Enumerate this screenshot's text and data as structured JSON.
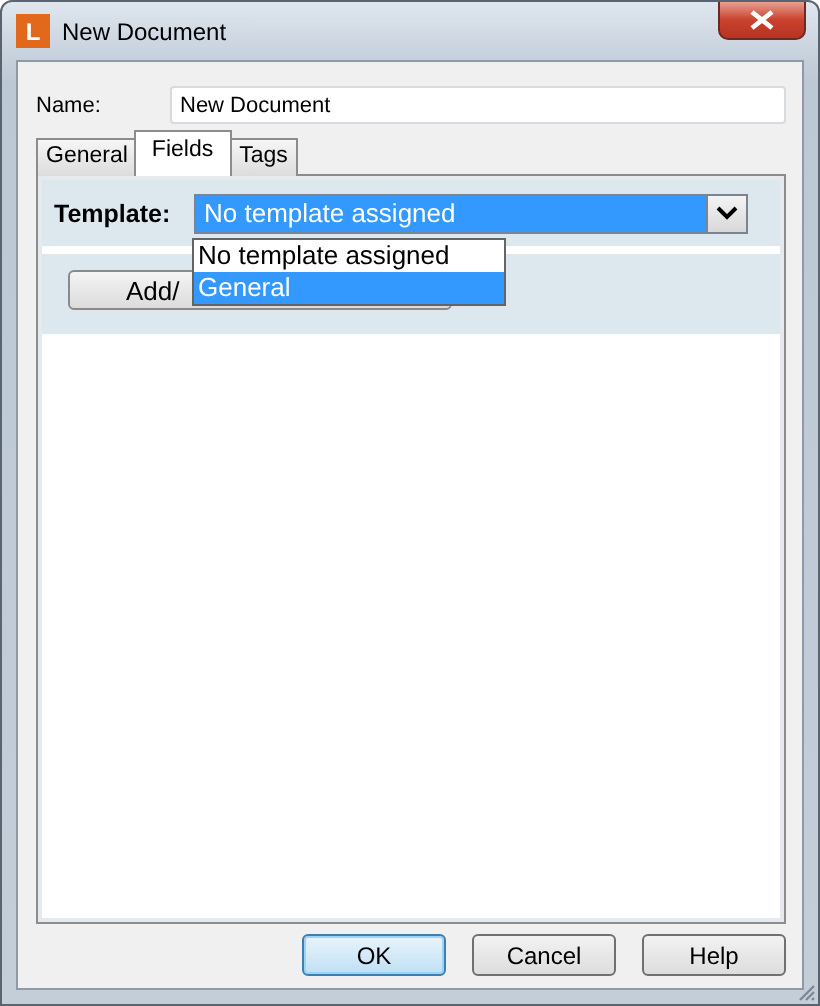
{
  "window": {
    "title": "New Document",
    "icon_letter": "L"
  },
  "name_field": {
    "label": "Name:",
    "value": "New Document"
  },
  "tabs": [
    {
      "label": "General",
      "selected": false
    },
    {
      "label": "Fields",
      "selected": true
    },
    {
      "label": "Tags",
      "selected": false
    }
  ],
  "template": {
    "label": "Template:",
    "value": "No template assigned",
    "options": [
      {
        "label": "No template assigned",
        "highlighted": false
      },
      {
        "label": "General",
        "highlighted": true
      }
    ]
  },
  "add_button": {
    "label": "Add/"
  },
  "buttons": [
    {
      "label": "OK",
      "default": true
    },
    {
      "label": "Cancel",
      "default": false
    },
    {
      "label": "Help",
      "default": false
    }
  ]
}
